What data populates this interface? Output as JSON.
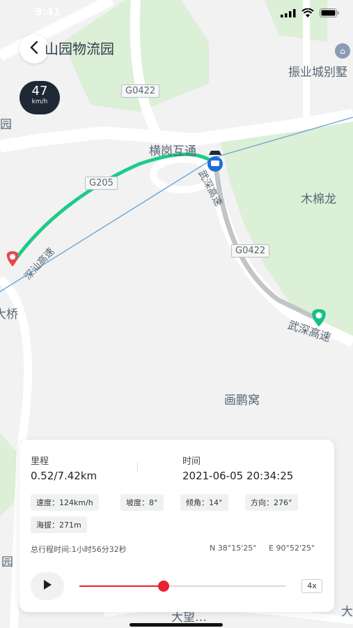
{
  "status_bar": {
    "time": "9:41"
  },
  "header": {
    "title": "山园物流园"
  },
  "speed_badge": {
    "value": "47",
    "unit": "km/h"
  },
  "map": {
    "place_labels": {
      "zhenye": "振业城别墅",
      "henggang": "横岗互通",
      "mumianlong": "木棉龙",
      "huapengwo": "画鹏窝",
      "left_park": "花园",
      "left_bridge": "大桥",
      "left_garden": "园",
      "bottom_right": "大",
      "bottom_center": "大望…"
    },
    "road_labels": {
      "g0422_top": "G0422",
      "g205": "G205",
      "g0422_mid": "G0422",
      "wushen_right": "武深高速",
      "wushen_diag": "武深高速",
      "left_road": "深汕高速"
    }
  },
  "info_panel": {
    "mileage_label": "里程",
    "mileage_value": "0.52/7.42km",
    "time_label": "时间",
    "time_value": "2021-06-05 20:34:25",
    "chips": [
      "速度：124km/h",
      "坡度：8°",
      "倾角：14°",
      "方向：276°",
      "海拔：271m"
    ],
    "total_time": "总行程时间:1小时56分32秒",
    "coord_n": "N 38°15'25\"",
    "coord_e": "E 90°52'25\"",
    "playback_speed": "4x",
    "progress": 0.41
  },
  "colors": {
    "route_done": "#1ccc8a",
    "route_remaining": "#c2c5c8",
    "start_pin": "#e9484b",
    "end_pin": "#16c184",
    "progress": "#e8222e"
  }
}
